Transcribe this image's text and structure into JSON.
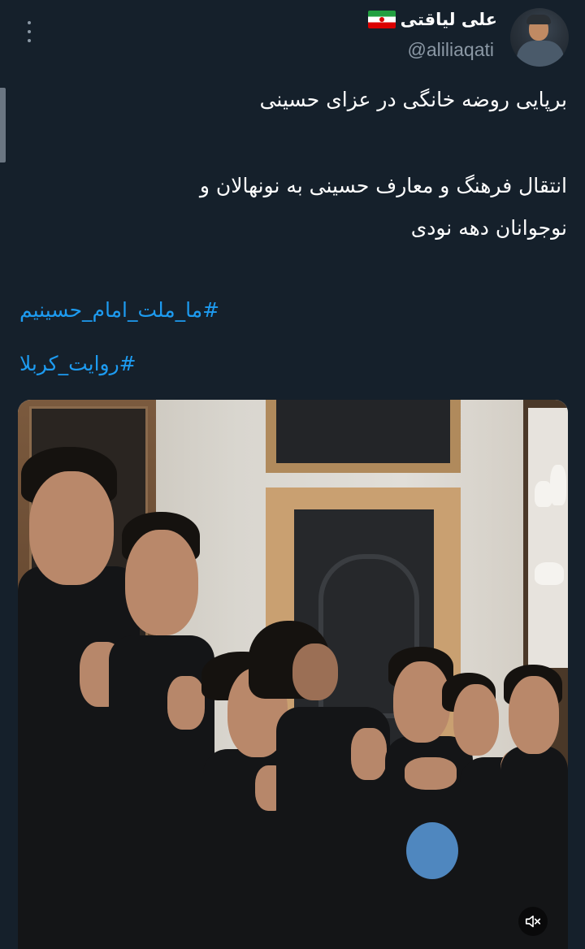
{
  "author": {
    "display_name": "علی لیاقتی",
    "flag_icon": "iran-flag-icon",
    "username": "@aliliaqati",
    "avatar_icon": "profile-avatar"
  },
  "tweet": {
    "lines": [
      "برپایی روضه خانگی در عزای حسینی",
      "انتقال فرهنگ و معارف حسینی به نونهالان و",
      "نوجوانان دهه نودی"
    ],
    "hashtags": [
      "#ما_ملت_امام_حسینیم",
      "#روایت_کربلا"
    ]
  },
  "media": {
    "type": "video",
    "description_icon": "video-thumbnail",
    "mute_icon": "speaker-muted-icon"
  },
  "colors": {
    "background": "#15202b",
    "text": "#ffffff",
    "secondary": "#8b98a5",
    "link": "#1d9bf0"
  }
}
